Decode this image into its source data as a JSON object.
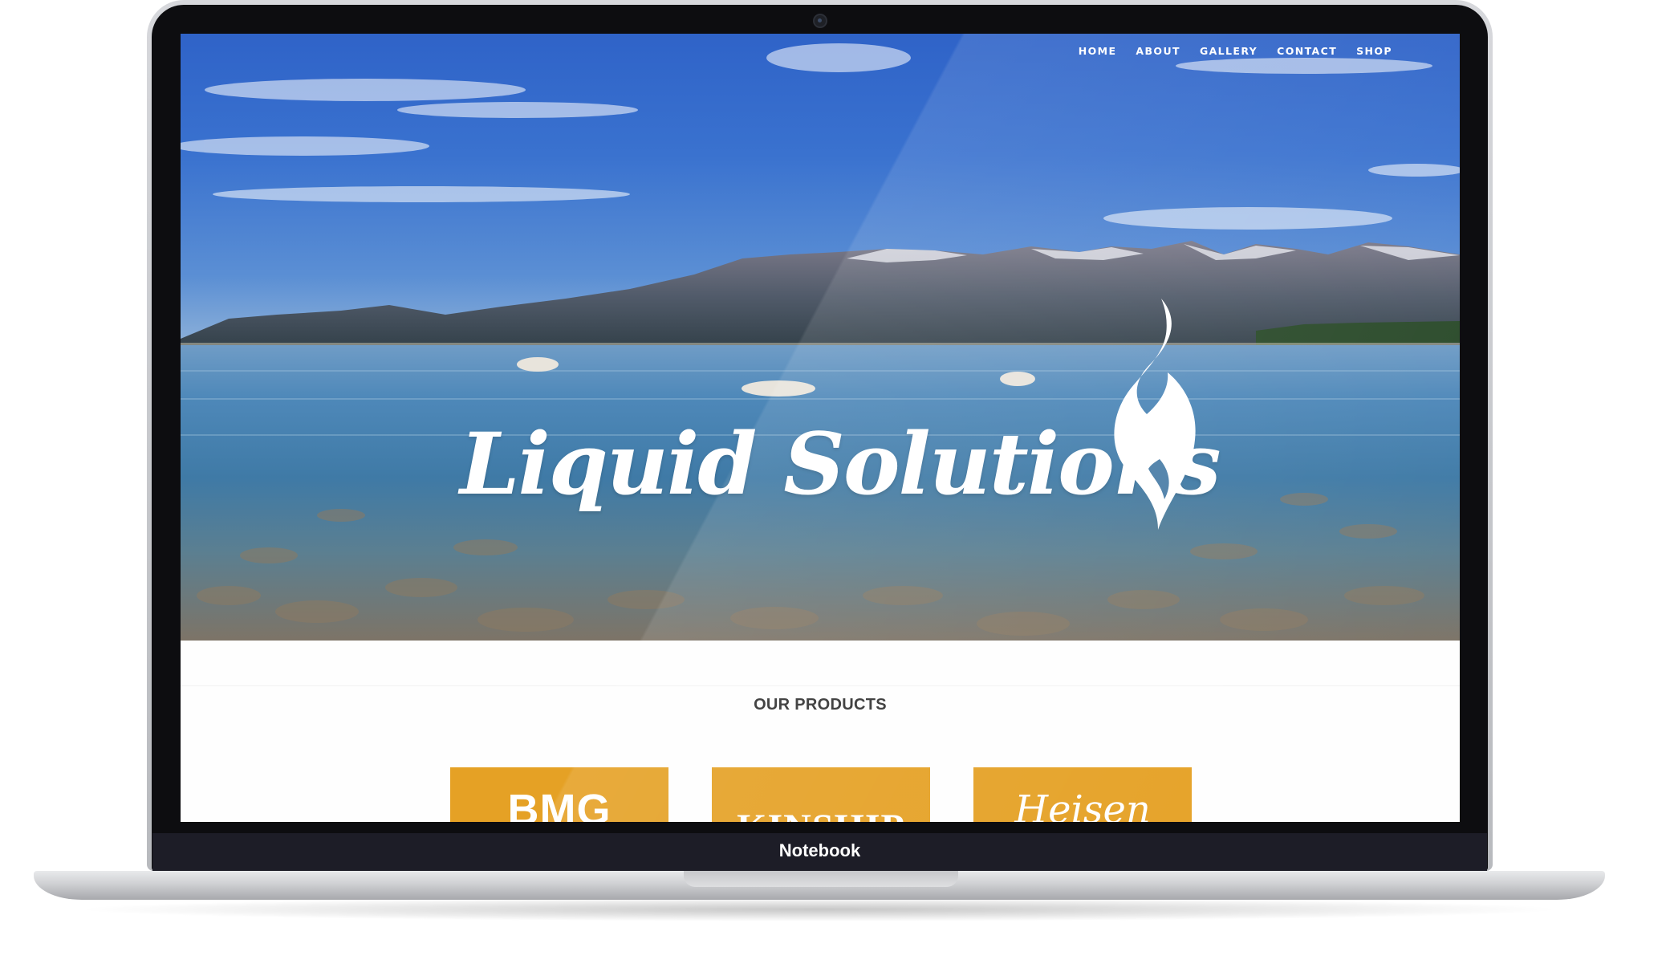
{
  "nav": {
    "home": "HOME",
    "about": "ABOUT",
    "gallery": "GALLERY",
    "contact": "CONTACT",
    "shop": "SHOP"
  },
  "hero": {
    "brand": "Liquid Solutions"
  },
  "products": {
    "heading": "OUR PRODUCTS",
    "items": [
      {
        "logo_text": "BMG"
      },
      {
        "logo_text": "KINSHIP"
      },
      {
        "logo_text": "Heisen Blue"
      }
    ]
  },
  "device": {
    "label": "Notebook"
  },
  "colors": {
    "product_tile": "#e5a125",
    "chin": "#1d1d27"
  }
}
